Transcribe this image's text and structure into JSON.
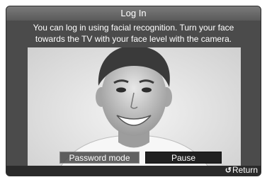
{
  "dialog": {
    "title": "Log In",
    "instruction_line1": "You can log in using facial recognition. Turn your face",
    "instruction_line2": "towards the TV with your face level with the camera."
  },
  "buttons": {
    "password_mode": "Password mode",
    "pause": "Pause"
  },
  "footer": {
    "return_icon": "↺",
    "return_label": "Return"
  },
  "camera": {
    "subject": "live camera feed of a smiling face"
  }
}
